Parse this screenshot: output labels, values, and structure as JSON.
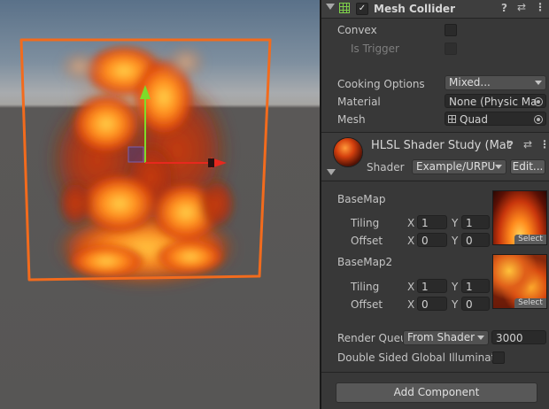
{
  "mesh_collider": {
    "title": "Mesh Collider",
    "enabled_check": "✓",
    "convex_label": "Convex",
    "is_trigger_label": "Is Trigger",
    "cooking_options_label": "Cooking Options",
    "cooking_options_value": "Mixed...",
    "material_label": "Material",
    "material_value": "None (Physic Ma",
    "mesh_label": "Mesh",
    "mesh_value": "Quad"
  },
  "material": {
    "title": "HLSL Shader Study (Mat",
    "shader_label": "Shader",
    "shader_value": "Example/URPU",
    "edit_label": "Edit...",
    "basemap_label": "BaseMap",
    "basemap2_label": "BaseMap2",
    "tiling_label": "Tiling",
    "offset_label": "Offset",
    "x_label": "X",
    "y_label": "Y",
    "basemap": {
      "tiling_x": "1",
      "tiling_y": "1",
      "offset_x": "0",
      "offset_y": "0"
    },
    "basemap2": {
      "tiling_x": "1",
      "tiling_y": "1",
      "offset_x": "0",
      "offset_y": "0"
    },
    "select_label": "Select",
    "render_queue_label": "Render Queu",
    "render_queue_mode": "From Shader",
    "render_queue_value": "3000",
    "double_sided_label": "Double Sided Global Illuminatio"
  },
  "add_component_label": "Add Component",
  "icons": [
    "mesh-collider-grid-icon",
    "help-icon",
    "preset-icon",
    "more-icon",
    "sphere-preview-icon",
    "object-picker-icon",
    "quad-mesh-icon",
    "move-gizmo-icon"
  ],
  "colors": {
    "selection_outline": "#f26b1d",
    "gizmo_y": "#7ddc2a",
    "gizmo_x": "#e8281e",
    "inspector_bg": "#383838"
  }
}
